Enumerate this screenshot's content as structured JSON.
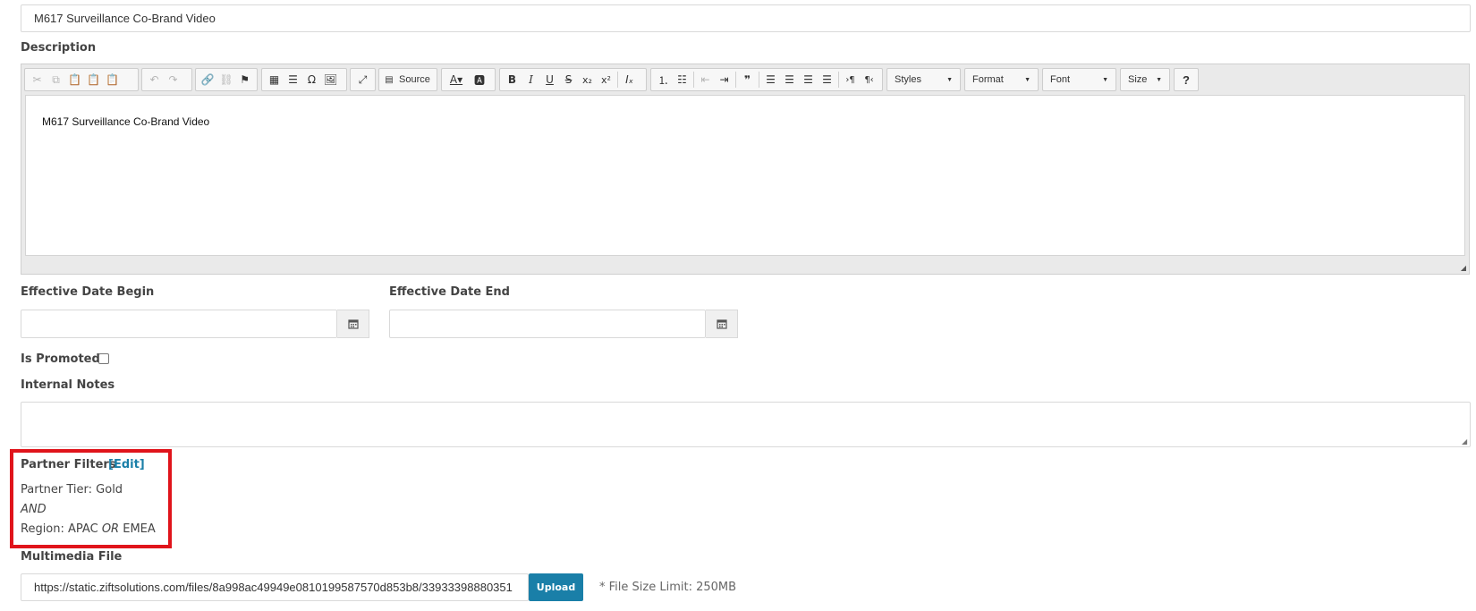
{
  "title_field": {
    "value": "M617 Surveillance Co-Brand Video"
  },
  "description": {
    "label": "Description",
    "content": "M617 Surveillance Co-Brand Video",
    "toolbar": {
      "source_label": "Source",
      "styles_label": "Styles",
      "format_label": "Format",
      "font_label": "Font",
      "size_label": "Size",
      "help_label": "?"
    }
  },
  "effective_date_begin": {
    "label": "Effective Date Begin",
    "value": ""
  },
  "effective_date_end": {
    "label": "Effective Date End",
    "value": ""
  },
  "is_promoted": {
    "label": "Is Promoted?",
    "checked": false
  },
  "internal_notes": {
    "label": "Internal Notes",
    "value": ""
  },
  "partner_filters": {
    "label": "Partner Filters",
    "edit_link": "[Edit]",
    "tier_prefix": "Partner Tier:",
    "tier_value": "Gold",
    "and_text": "AND",
    "region_prefix": "Region:",
    "region_value_1": "APAC",
    "or_text": "OR",
    "region_value_2": "EMEA",
    "highlight_color": "#e0141b"
  },
  "multimedia_file": {
    "label": "Multimedia File",
    "value": "https://static.ziftsolutions.com/files/8a998ac49949e0810199587570d853b8/33933398880351",
    "upload_label": "Upload",
    "size_limit": "* File Size Limit: 250MB"
  },
  "colors": {
    "accent": "#1a7fa8",
    "link": "#1a7fa8"
  }
}
